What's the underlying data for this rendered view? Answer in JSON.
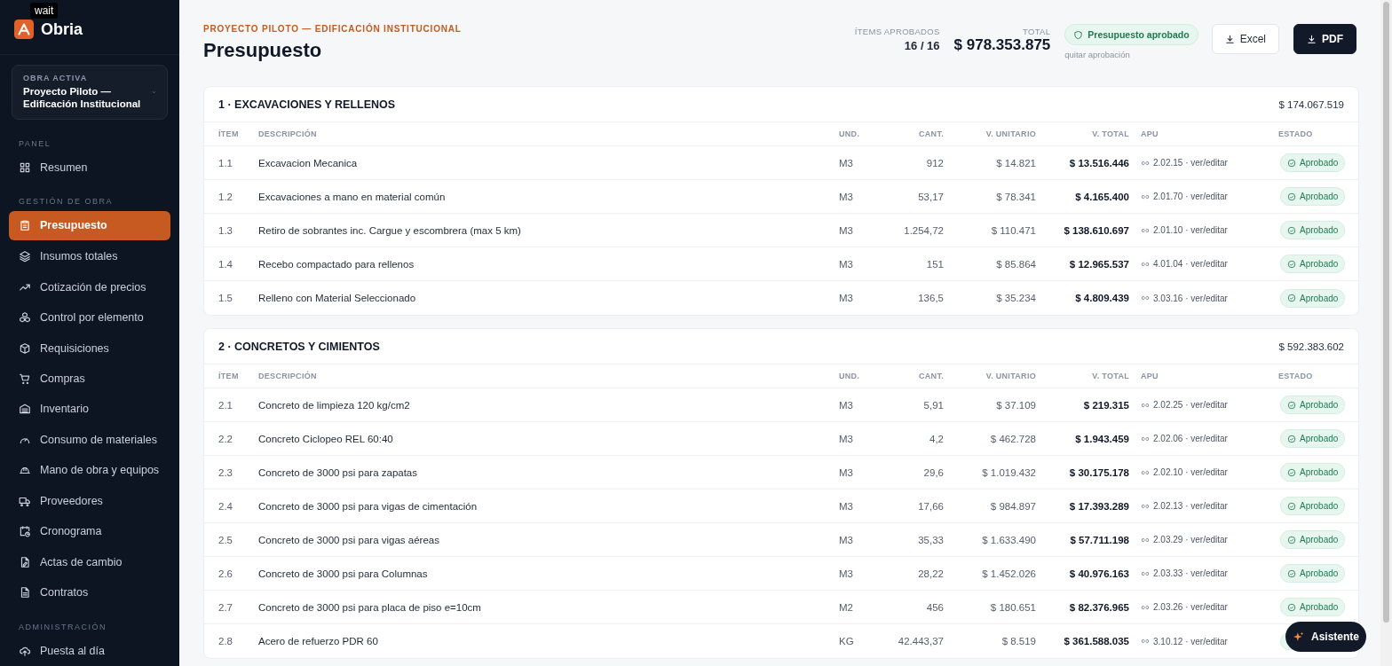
{
  "app": {
    "logo_text": "Obria",
    "tooltip": "wait"
  },
  "active_project": {
    "label": "OBRA ACTIVA",
    "name": "Proyecto Piloto — Edificación Institucional"
  },
  "sidebar": {
    "groups": [
      {
        "label": "PANEL",
        "items": [
          {
            "label": "Resumen",
            "selected": false
          }
        ]
      },
      {
        "label": "GESTIÓN DE OBRA",
        "items": [
          {
            "label": "Presupuesto",
            "selected": true
          },
          {
            "label": "Insumos totales",
            "selected": false
          },
          {
            "label": "Cotización de precios",
            "selected": false
          },
          {
            "label": "Control por elemento",
            "selected": false
          },
          {
            "label": "Requisiciones",
            "selected": false
          },
          {
            "label": "Compras",
            "selected": false
          },
          {
            "label": "Inventario",
            "selected": false
          },
          {
            "label": "Consumo de materiales",
            "selected": false
          },
          {
            "label": "Mano de obra y equipos",
            "selected": false
          },
          {
            "label": "Proveedores",
            "selected": false
          },
          {
            "label": "Cronograma",
            "selected": false
          },
          {
            "label": "Actas de cambio",
            "selected": false
          },
          {
            "label": "Contratos",
            "selected": false
          }
        ]
      },
      {
        "label": "ADMINISTRACIÓN",
        "items": [
          {
            "label": "Puesta al día",
            "selected": false
          }
        ]
      }
    ]
  },
  "header": {
    "eyebrow": "PROYECTO PILOTO — EDIFICACIÓN INSTITUCIONAL",
    "title": "Presupuesto",
    "approved_items": {
      "label": "ÍTEMS APROBADOS",
      "value": "16 / 16"
    },
    "total": {
      "label": "TOTAL",
      "value": "$ 978.353.875"
    },
    "approval": {
      "approved": true,
      "badge": "Presupuesto aprobado",
      "link": "quitar aprobación"
    },
    "buttons": [
      "Excel",
      "PDF"
    ]
  },
  "sections": [
    {
      "title": "1 · EXCAVACIONES Y RELLENOS",
      "total": "$ 174.067.519",
      "columns": [
        "ÍTEM",
        "DESCRIPCIÓN",
        "UND.",
        "CANT.",
        "V. UNITARIO",
        "V. TOTAL",
        "APU",
        "ESTADO"
      ],
      "rows": [
        {
          "item": "1.1",
          "description": "Excavacion Mecanica",
          "unit": "M3",
          "qty": "912",
          "unit_price": "$ 14.821",
          "total": "$ 13.516.446",
          "apu": "2.02.15 · ver/editar",
          "status": "Aprobado",
          "approved": true
        },
        {
          "item": "1.2",
          "description": "Excavaciones a mano en material común",
          "unit": "M3",
          "qty": "53,17",
          "unit_price": "$ 78.341",
          "total": "$ 4.165.400",
          "apu": "2.01.70 · ver/editar",
          "status": "Aprobado",
          "approved": true
        },
        {
          "item": "1.3",
          "description": "Retiro de sobrantes inc. Cargue y escombrera (max 5 km)",
          "unit": "M3",
          "qty": "1.254,72",
          "unit_price": "$ 110.471",
          "total": "$ 138.610.697",
          "apu": "2.01.10 · ver/editar",
          "status": "Aprobado",
          "approved": true
        },
        {
          "item": "1.4",
          "description": "Recebo compactado para rellenos",
          "unit": "M3",
          "qty": "151",
          "unit_price": "$ 85.864",
          "total": "$ 12.965.537",
          "apu": "4.01.04 · ver/editar",
          "status": "Aprobado",
          "approved": true
        },
        {
          "item": "1.5",
          "description": "Relleno con Material Seleccionado",
          "unit": "M3",
          "qty": "136,5",
          "unit_price": "$ 35.234",
          "total": "$ 4.809.439",
          "apu": "3.03.16 · ver/editar",
          "status": "Aprobado",
          "approved": true
        }
      ]
    },
    {
      "title": "2 · CONCRETOS Y CIMIENTOS",
      "total": "$ 592.383.602",
      "columns": [
        "ÍTEM",
        "DESCRIPCIÓN",
        "UND.",
        "CANT.",
        "V. UNITARIO",
        "V. TOTAL",
        "APU",
        "ESTADO"
      ],
      "rows": [
        {
          "item": "2.1",
          "description": "Concreto de limpieza 120 kg/cm2",
          "unit": "M3",
          "qty": "5,91",
          "unit_price": "$ 37.109",
          "total": "$ 219.315",
          "apu": "2.02.25 · ver/editar",
          "status": "Aprobado",
          "approved": true
        },
        {
          "item": "2.2",
          "description": "Concreto Ciclopeo REL 60:40",
          "unit": "M3",
          "qty": "4,2",
          "unit_price": "$ 462.728",
          "total": "$ 1.943.459",
          "apu": "2.02.06 · ver/editar",
          "status": "Aprobado",
          "approved": true
        },
        {
          "item": "2.3",
          "description": "Concreto de 3000 psi para zapatas",
          "unit": "M3",
          "qty": "29,6",
          "unit_price": "$ 1.019.432",
          "total": "$ 30.175.178",
          "apu": "2.02.10 · ver/editar",
          "status": "Aprobado",
          "approved": true
        },
        {
          "item": "2.4",
          "description": "Concreto de 3000 psi para vigas de cimentación",
          "unit": "M3",
          "qty": "17,66",
          "unit_price": "$ 984.897",
          "total": "$ 17.393.289",
          "apu": "2.02.13 · ver/editar",
          "status": "Aprobado",
          "approved": true
        },
        {
          "item": "2.5",
          "description": "Concreto de 3000 psi para vigas aéreas",
          "unit": "M3",
          "qty": "35,33",
          "unit_price": "$ 1.633.490",
          "total": "$ 57.711.198",
          "apu": "2.03.29 · ver/editar",
          "status": "Aprobado",
          "approved": true
        },
        {
          "item": "2.6",
          "description": "Concreto de 3000 psi para Columnas",
          "unit": "M3",
          "qty": "28,22",
          "unit_price": "$ 1.452.026",
          "total": "$ 40.976.163",
          "apu": "2.03.33 · ver/editar",
          "status": "Aprobado",
          "approved": true
        },
        {
          "item": "2.7",
          "description": "Concreto de 3000 psi para placa de piso e=10cm",
          "unit": "M2",
          "qty": "456",
          "unit_price": "$ 180.651",
          "total": "$ 82.376.965",
          "apu": "2.03.26 · ver/editar",
          "status": "Aprobado",
          "approved": true
        },
        {
          "item": "2.8",
          "description": "Acero de refuerzo PDR 60",
          "unit": "KG",
          "qty": "42.443,37",
          "unit_price": "$ 8.519",
          "total": "$ 361.588.035",
          "apu": "3.10.12 · ver/editar",
          "approved": true
        }
      ]
    }
  ],
  "assistant_button": "Asistente"
}
